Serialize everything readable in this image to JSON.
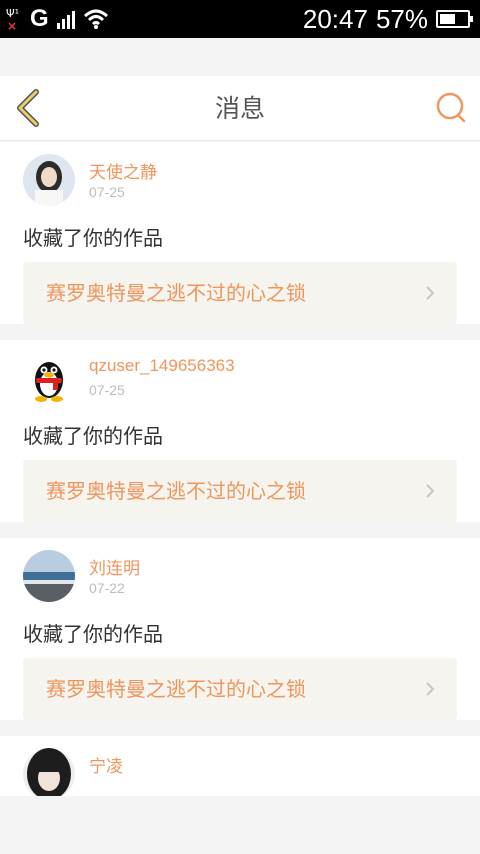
{
  "status_bar": {
    "time": "20:47",
    "battery_percent_label": "57%",
    "battery_level": 0.57,
    "network": "G",
    "icons": [
      "sim-antenna-icon",
      "no-sim-icon",
      "signal-bars-icon",
      "wifi-icon",
      "battery-icon"
    ]
  },
  "header": {
    "title": "消息",
    "back_icon": "chevron-left-icon",
    "search_icon": "search-icon"
  },
  "colors": {
    "accent": "#f0955b",
    "back_icon": "#e8d066",
    "card_tag_bg": "#f5f4ef"
  },
  "messages": [
    {
      "username": "天使之静",
      "date": "07-25",
      "action": "收藏了你的作品",
      "work_title": "赛罗奥特曼之逃不过的心之锁",
      "avatar": "girl-photo"
    },
    {
      "username": "qzuser_149656363",
      "date": "07-25",
      "action": "收藏了你的作品",
      "work_title": "赛罗奥特曼之逃不过的心之锁",
      "avatar": "qq-penguin"
    },
    {
      "username": "刘连明",
      "date": "07-22",
      "action": "收藏了你的作品",
      "work_title": "赛罗奥特曼之逃不过的心之锁",
      "avatar": "sea-photo"
    },
    {
      "username": "宁凌",
      "avatar": "dark-hair-photo"
    }
  ]
}
